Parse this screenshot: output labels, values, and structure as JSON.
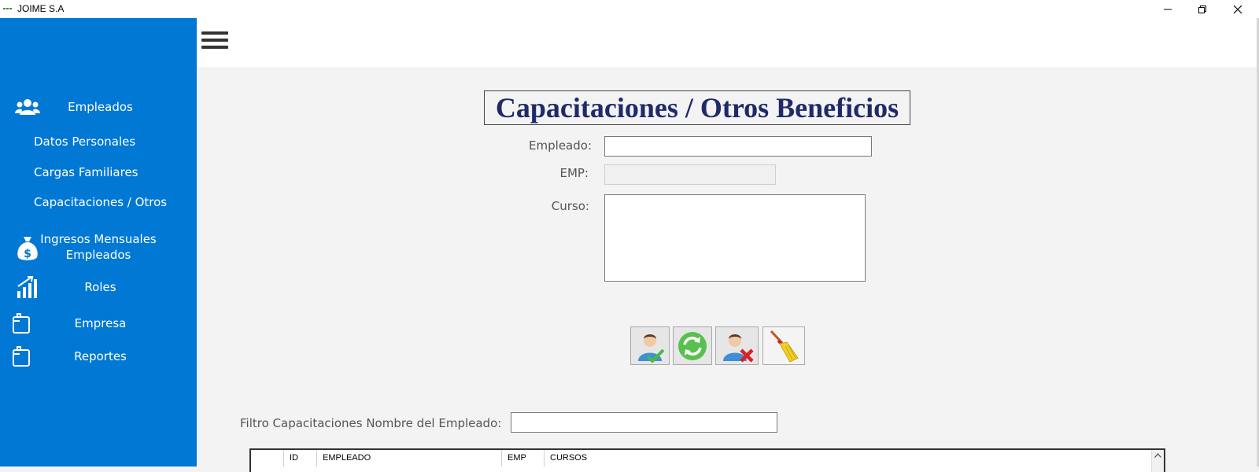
{
  "window": {
    "title": "JOIME S.A"
  },
  "sidebar": {
    "empleados": "Empleados",
    "datos_personales": "Datos Personales",
    "cargas_familiares": "Cargas Familiares",
    "capacitaciones": "Capacitaciones / Otros",
    "ingresos_line1": "Ingresos Mensuales",
    "ingresos_line2": "Empleados",
    "roles": "Roles",
    "empresa": "Empresa",
    "reportes": "Reportes"
  },
  "form": {
    "title": "Capacitaciones / Otros Beneficios",
    "empleado_label": "Empleado:",
    "empleado_value": "",
    "emp_label": "EMP:",
    "emp_value": "",
    "curso_label": "Curso:",
    "curso_value": ""
  },
  "filter": {
    "label": "Filtro Capacitaciones Nombre del Empleado:",
    "value": ""
  },
  "grid": {
    "columns": [
      "",
      "ID",
      "EMPLEADO",
      "EMP",
      "CURSOS"
    ]
  },
  "colors": {
    "sidebar": "#0078d4",
    "title": "#1f2a68"
  }
}
